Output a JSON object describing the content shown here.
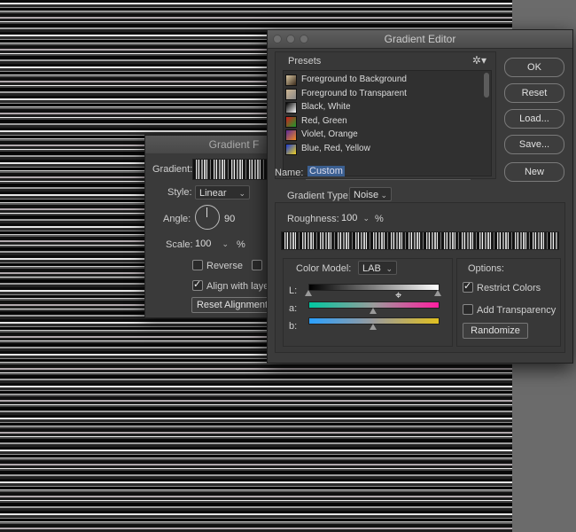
{
  "gradient_fill": {
    "title": "Gradient F",
    "gradient_label": "Gradient:",
    "style_label": "Style:",
    "style_value": "Linear",
    "angle_label": "Angle:",
    "angle_value": "90",
    "scale_label": "Scale:",
    "scale_value": "100",
    "scale_unit": "%",
    "reverse_label": "Reverse",
    "align_label": "Align with layer",
    "reset_button": "Reset Alignment"
  },
  "gradient_editor": {
    "title": "Gradient Editor",
    "presets_label": "Presets",
    "presets": [
      {
        "label": "Foreground to Background",
        "swatch": [
          "#d9c7a4",
          "#3a2a1a"
        ]
      },
      {
        "label": "Foreground to Transparent",
        "swatch": [
          "#cdb592",
          "#888888"
        ]
      },
      {
        "label": "Black, White",
        "swatch": [
          "#000000",
          "#ffffff"
        ]
      },
      {
        "label": "Red, Green",
        "swatch": [
          "#d12020",
          "#1b9a2a"
        ]
      },
      {
        "label": "Violet, Orange",
        "swatch": [
          "#5a2a9a",
          "#f08a20"
        ]
      },
      {
        "label": "Blue, Red, Yellow",
        "swatch": [
          "#1a3ad0",
          "#f0d020"
        ]
      }
    ],
    "buttons": {
      "ok": "OK",
      "reset": "Reset",
      "load": "Load...",
      "save": "Save...",
      "new": "New"
    },
    "name_label": "Name:",
    "name_value": "Custom",
    "gradient_type_label": "Gradient Type:",
    "gradient_type_value": "Noise",
    "roughness_label": "Roughness:",
    "roughness_value": "100",
    "roughness_unit": "%",
    "color_model_label": "Color Model:",
    "color_model_value": "LAB",
    "channels": {
      "l": "L:",
      "a": "a:",
      "b": "b:"
    },
    "options_label": "Options:",
    "restrict_colors": "Restrict Colors",
    "add_transparency": "Add Transparency",
    "randomize": "Randomize"
  }
}
